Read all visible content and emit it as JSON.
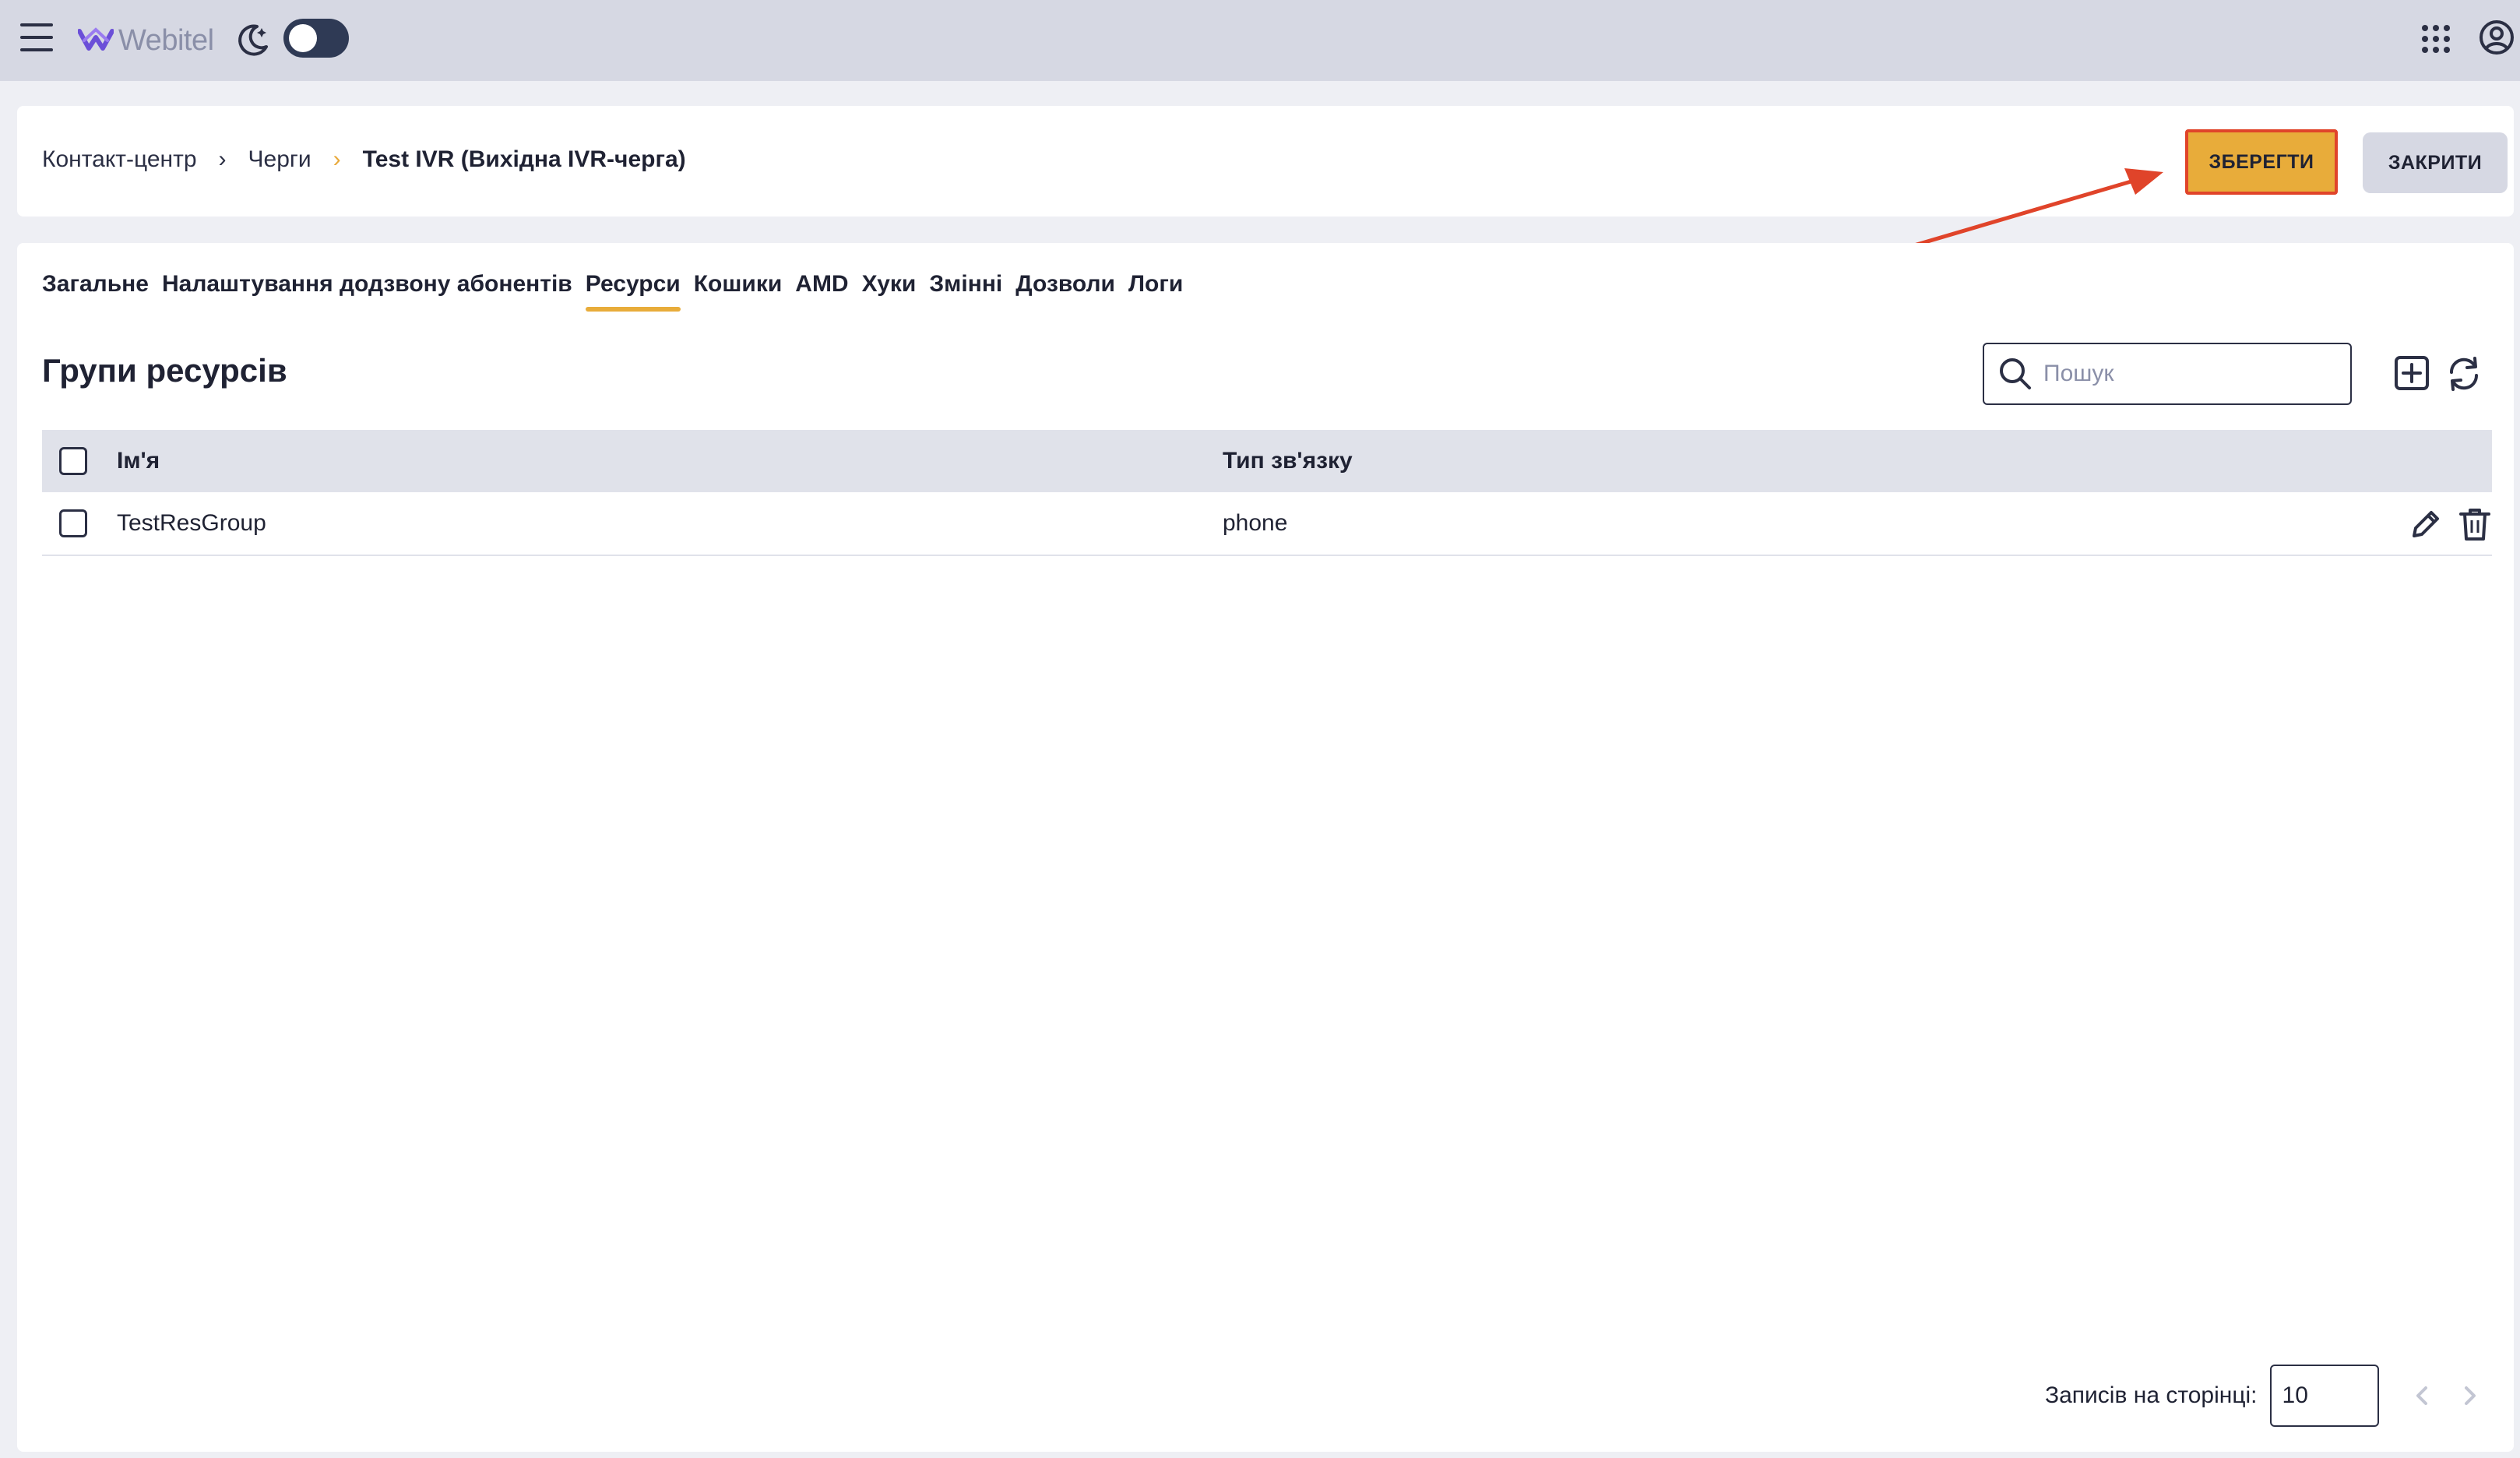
{
  "app": {
    "brand": "Webitel",
    "theme_toggle_on": false
  },
  "breadcrumb": {
    "items": [
      "Контакт-центр",
      "Черги"
    ],
    "current": "Test IVR (Вихідна IVR-черга)"
  },
  "actions": {
    "save_label": "ЗБЕРЕГТИ",
    "close_label": "ЗАКРИТИ"
  },
  "tabs": [
    {
      "label": "Загальне",
      "active": false
    },
    {
      "label": "Налаштування додзвону абонентів",
      "active": false
    },
    {
      "label": "Ресурси",
      "active": true
    },
    {
      "label": "Кошики",
      "active": false
    },
    {
      "label": "AMD",
      "active": false
    },
    {
      "label": "Хуки",
      "active": false
    },
    {
      "label": "Змінні",
      "active": false
    },
    {
      "label": "Дозволи",
      "active": false
    },
    {
      "label": "Логи",
      "active": false
    }
  ],
  "section": {
    "title": "Групи ресурсів",
    "search_placeholder": "Пошук",
    "search_value": ""
  },
  "table": {
    "columns": {
      "name": "Ім'я",
      "type": "Тип зв'язку"
    },
    "rows": [
      {
        "name": "TestResGroup",
        "type": "phone"
      }
    ]
  },
  "pagination": {
    "label": "Записів на сторінці:",
    "page_size": "10"
  },
  "colors": {
    "accent": "#e8ac3a",
    "annotation": "#e0442a",
    "topbar": "#d6d8e3",
    "text": "#1f2233"
  }
}
